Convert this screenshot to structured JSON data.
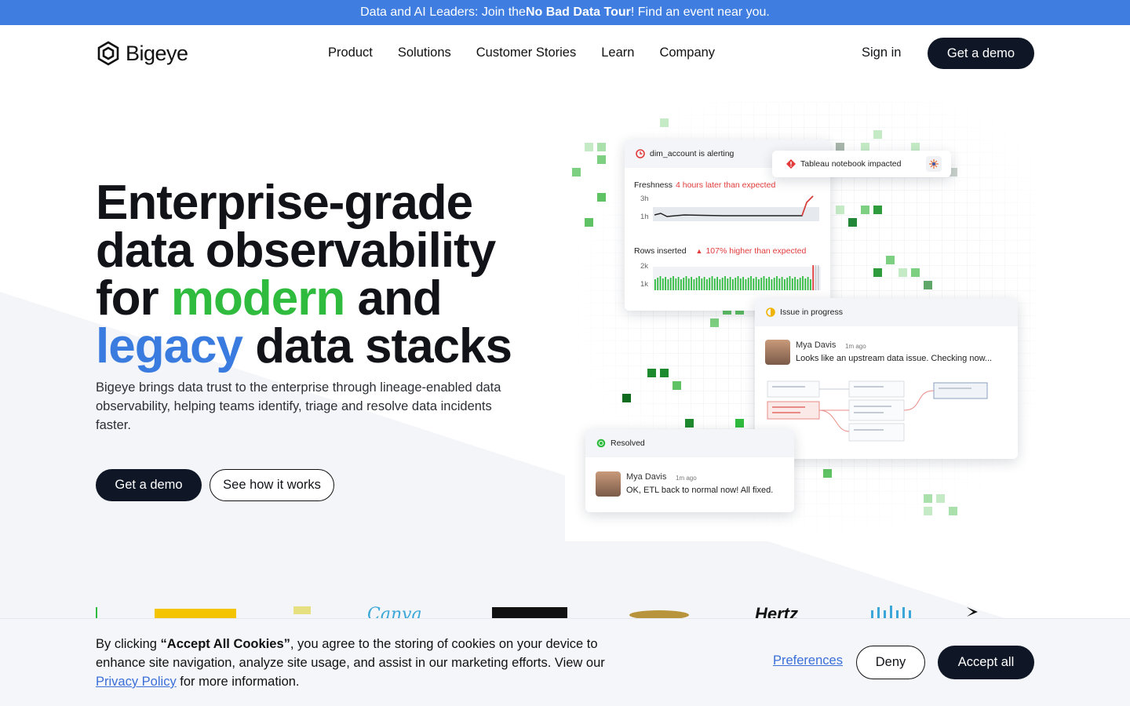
{
  "banner": {
    "prefix": "Data and AI Leaders: Join the ",
    "bold": "No Bad Data Tour",
    "suffix": "! Find an event near you."
  },
  "brand": {
    "name": "Bigeye"
  },
  "nav": {
    "items": [
      "Product",
      "Solutions",
      "Customer Stories",
      "Learn",
      "Company"
    ],
    "sign_in": "Sign in",
    "demo": "Get a demo"
  },
  "hero": {
    "line1": "Enterprise-grade",
    "line2": "data observability",
    "line3_pre": "for ",
    "line3_green": "modern",
    "line3_post": " and",
    "line4_blue": "legacy",
    "line4_post": " data stacks",
    "subtitle": "Bigeye brings data trust to the enterprise through lineage-enabled data observability, helping teams identify, triage and resolve data incidents faster.",
    "cta_primary": "Get a demo",
    "cta_secondary": "See how it works"
  },
  "viz": {
    "alert_title": "dim_account is alerting",
    "impact_title": "Tableau notebook impacted",
    "freshness_label": "Freshness",
    "freshness_note": "4 hours later than expected",
    "freshness_ticks": [
      "3h",
      "1h"
    ],
    "rows_label": "Rows inserted",
    "rows_note": "107% higher than expected",
    "rows_ticks": [
      "2k",
      "1k"
    ],
    "issue_title": "Issue in progress",
    "issue_user": "Mya Davis",
    "issue_time": "1m ago",
    "issue_msg": "Looks like an upstream data issue. Checking now...",
    "resolved_title": "Resolved",
    "resolved_user": "Mya Davis",
    "resolved_time": "1m ago",
    "resolved_msg": "OK, ETL back to normal now! All fixed."
  },
  "cookie": {
    "pre": "By clicking ",
    "bold": "“Accept All Cookies”",
    "mid": ", you agree to the storing of cookies on your device to enhance site navigation, analyze site usage, and assist in our marketing efforts. View our ",
    "policy": "Privacy Policy",
    "post": " for more information.",
    "preferences": "Preferences",
    "deny": "Deny",
    "accept": "Accept all"
  },
  "colors": {
    "banner": "#3f7ee0",
    "accent_green": "#2fbb3e",
    "accent_blue": "#3a7be0",
    "dark": "#0f1726",
    "alert_red": "#e23b3b"
  }
}
